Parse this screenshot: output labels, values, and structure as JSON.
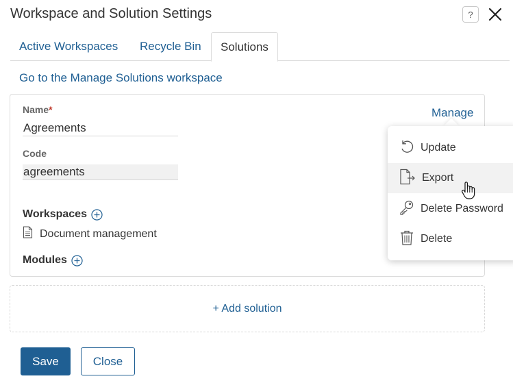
{
  "dialog": {
    "title": "Workspace and Solution Settings",
    "help_label": "?"
  },
  "tabs": [
    {
      "label": "Active Workspaces",
      "active": false
    },
    {
      "label": "Recycle Bin",
      "active": false
    },
    {
      "label": "Solutions",
      "active": true
    }
  ],
  "manage_solutions_link": "Go to the Manage Solutions workspace",
  "solution_card": {
    "name_label": "Name",
    "name_required_mark": "*",
    "name_value": "Agreements",
    "code_label": "Code",
    "code_value": "agreements",
    "workspaces_label": "Workspaces",
    "workspaces": [
      {
        "name": "Document management",
        "icon": "document-icon"
      }
    ],
    "modules_label": "Modules",
    "manage_label": "Manage"
  },
  "manage_menu": {
    "items": [
      {
        "label": "Update",
        "icon": "undo-arrow-icon"
      },
      {
        "label": "Export",
        "icon": "file-export-icon",
        "hovered": true
      },
      {
        "label": "Delete Password",
        "icon": "key-icon"
      },
      {
        "label": "Delete",
        "icon": "trash-icon"
      }
    ]
  },
  "add_solution_label": "+ Add solution",
  "footer": {
    "save_label": "Save",
    "close_label": "Close"
  },
  "colors": {
    "accent": "#1f5f93",
    "required": "#c0392b",
    "border": "#dcdcdc"
  }
}
